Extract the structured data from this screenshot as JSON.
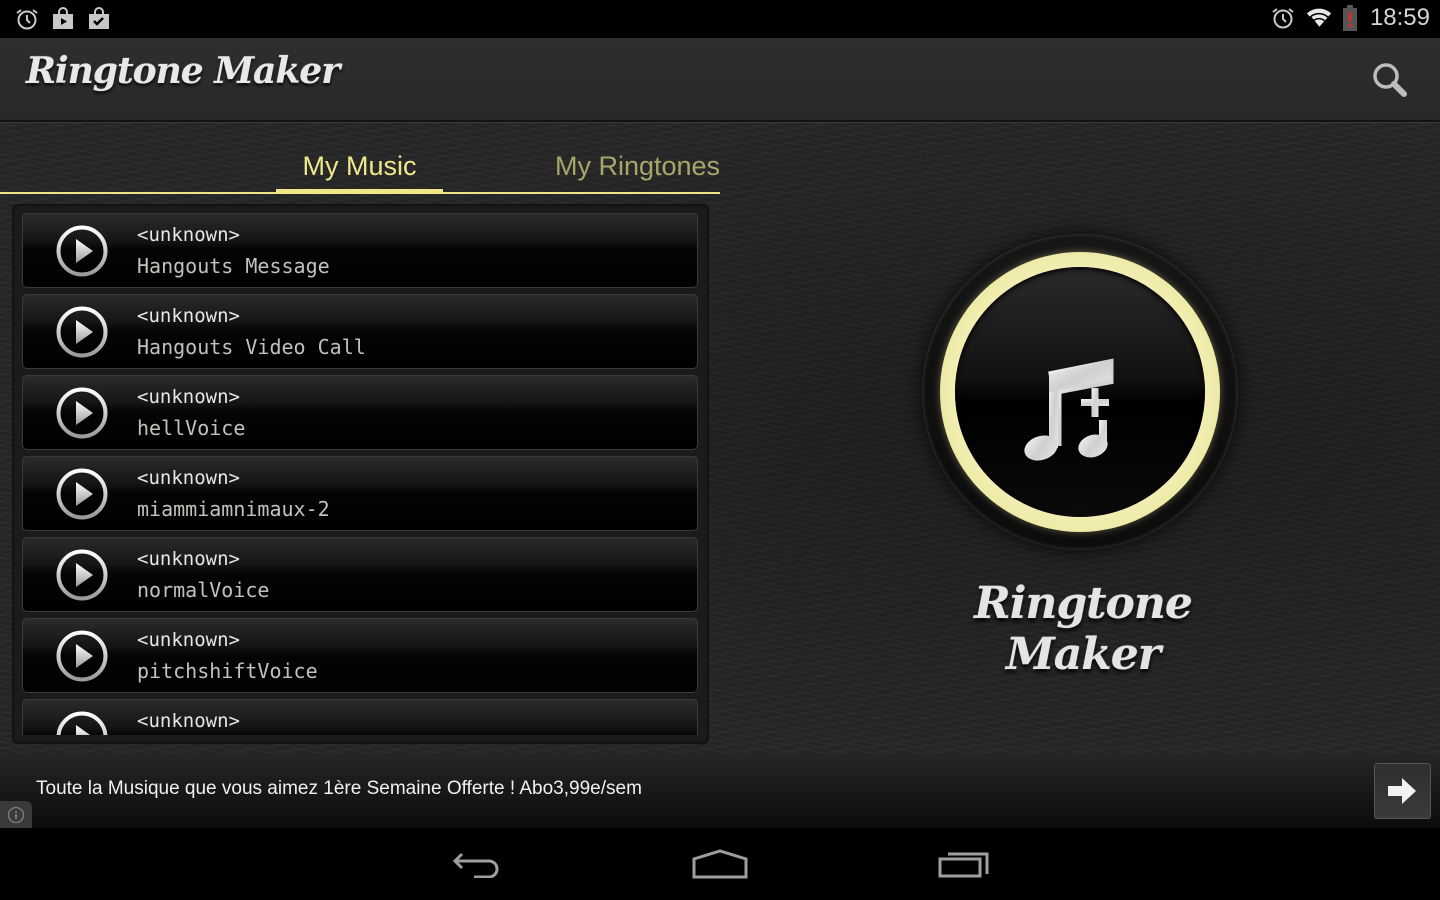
{
  "status_bar": {
    "left_icons": [
      "alarm-icon",
      "play-store-icon",
      "store-check-icon"
    ],
    "right_icons": [
      "alarm-icon",
      "wifi-icon",
      "battery-low-icon"
    ],
    "time": "18:59"
  },
  "action_bar": {
    "title": "Ringtone Maker",
    "search_icon": "search-icon"
  },
  "tabs": [
    {
      "label": "My Music",
      "selected": true
    },
    {
      "label": "My Ringtones",
      "selected": false
    }
  ],
  "song_list": [
    {
      "artist": "<unknown>",
      "title": "Hangouts Message"
    },
    {
      "artist": "<unknown>",
      "title": "Hangouts Video Call"
    },
    {
      "artist": "<unknown>",
      "title": "hellVoice"
    },
    {
      "artist": "<unknown>",
      "title": "miammiamnimaux-2"
    },
    {
      "artist": "<unknown>",
      "title": "normalVoice"
    },
    {
      "artist": "<unknown>",
      "title": "pitchshiftVoice"
    },
    {
      "artist": "<unknown>",
      "title": ""
    }
  ],
  "main_panel": {
    "button_icon": "add-music-icon",
    "logo_text": "Ringtone Maker"
  },
  "ad_banner": {
    "text": "Toute la Musique que vous aimez 1ère Semaine Offerte ! Abo3,99e/sem",
    "arrow_icon": "arrow-right-icon",
    "info_icon": "info-icon"
  },
  "nav_bar": [
    "back-icon",
    "home-icon",
    "recents-icon"
  ],
  "colors": {
    "accent": "#efe88a",
    "tab_inactive": "#a9a66a",
    "background": "#262626"
  }
}
